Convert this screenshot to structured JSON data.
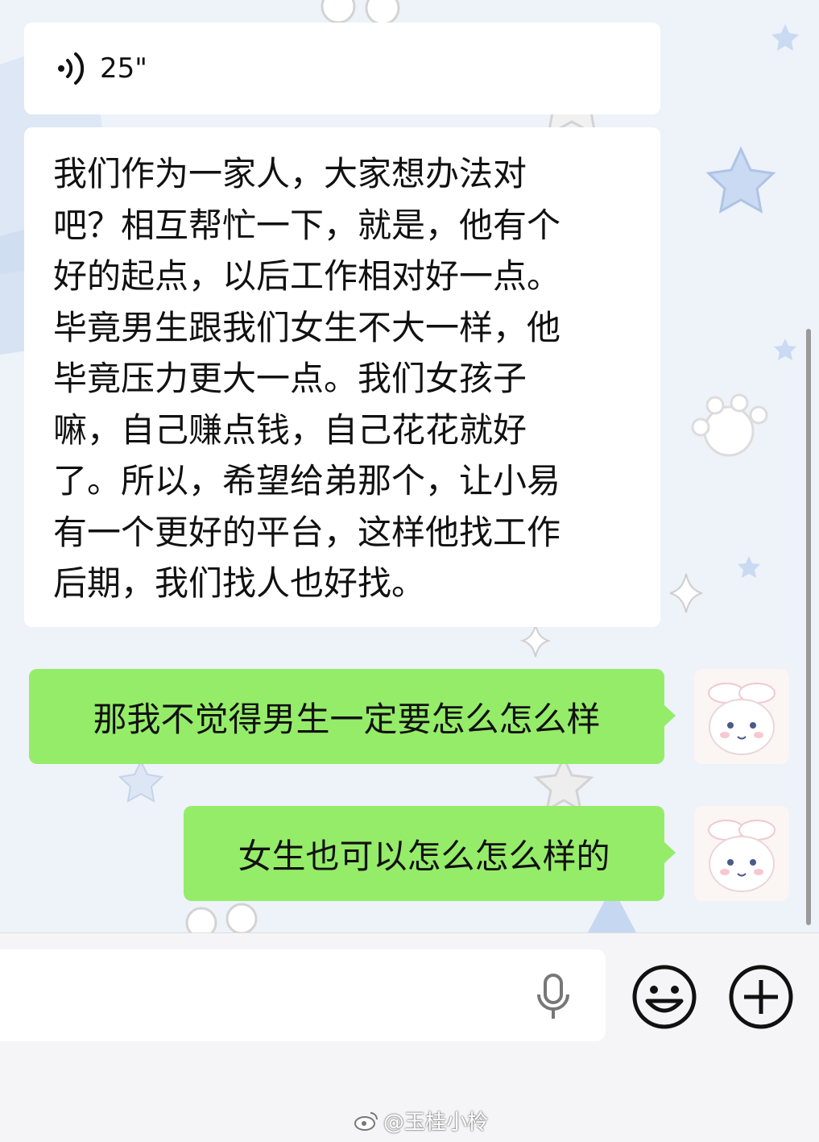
{
  "messages": [
    {
      "side": "left",
      "type": "voice",
      "duration": "25\""
    },
    {
      "side": "left",
      "type": "text",
      "lines": [
        "我们作为一家人，大家想办法对",
        "吧？相互帮忙一下，就是，他有个",
        "好的起点，以后工作相对好一点。",
        "毕竟男生跟我们女生不大一样，他",
        "毕竟压力更大一点。我们女孩子",
        "嘛，自己赚点钱，自己花花就好",
        "了。所以，希望给弟那个，让小易",
        "有一个更好的平台，这样他找工作",
        "后期，我们找人也好找。"
      ]
    },
    {
      "side": "right",
      "type": "text",
      "text": "那我不觉得男生一定要怎么怎么样"
    },
    {
      "side": "right",
      "type": "text",
      "text": "女生也可以怎么怎么样的"
    }
  ],
  "watermark": "@玉桂小柃",
  "icons": {
    "voice": "voice-wave-icon",
    "mic": "microphone-icon",
    "emoji": "emoji-icon",
    "add": "plus-circle-icon",
    "avatar": "cinnamoroll-avatar",
    "watermark_logo": "weibo-logo-icon"
  },
  "colors": {
    "background": "#eef2f9",
    "received_bubble": "#ffffff",
    "sent_bubble": "#95ec69",
    "text": "#111111"
  }
}
